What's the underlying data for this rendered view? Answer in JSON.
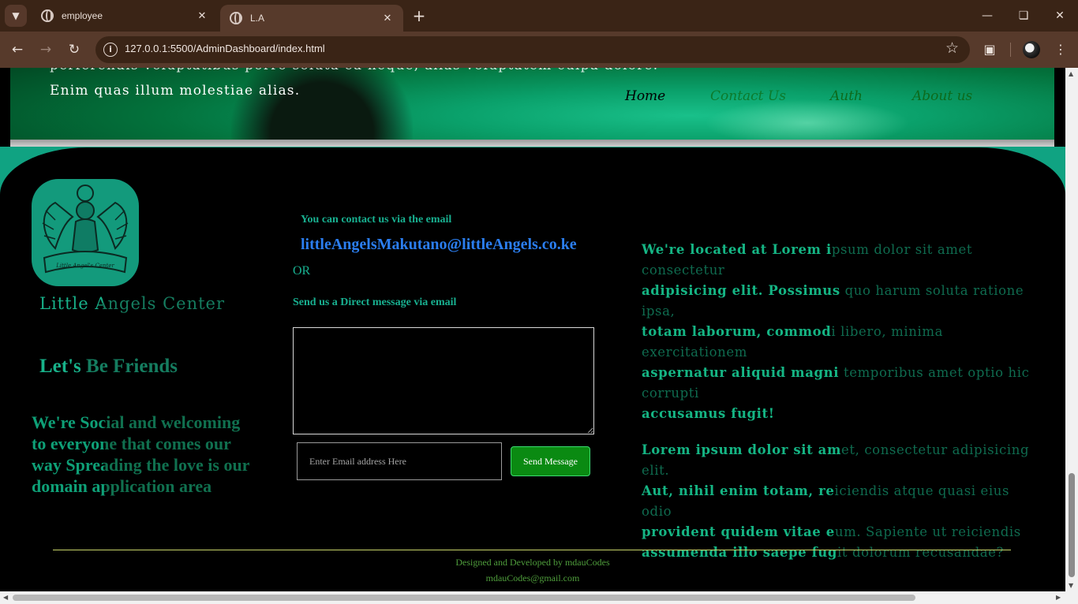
{
  "browser": {
    "tabs": [
      {
        "title": "employee",
        "active": false
      },
      {
        "title": "L.A",
        "active": true
      }
    ],
    "url": "127.0.0.1:5500/AdminDashboard/index.html",
    "icons": {
      "tab_menu": "chevron-down-icon",
      "new_tab": "plus-icon",
      "back": "back-arrow-icon",
      "forward": "forward-arrow-icon",
      "reload": "reload-icon",
      "site_info": "info-icon",
      "bookmark": "star-icon",
      "extensions": "puzzle-icon",
      "profile": "avatar-icon",
      "menu": "kebab-menu-icon"
    },
    "colors": {
      "tabbar": "#3a2416",
      "toolbar": "#573a2b"
    }
  },
  "hero": {
    "partial_line": "perferendis voluptatibus porro soluta ea neque, alias voluptatem culpa dolore.",
    "line": "Enim quas illum molestiae alias.",
    "nav": [
      {
        "label": "Home",
        "color": "#000000"
      },
      {
        "label": "Contact Us",
        "color": "#0c7a2c"
      },
      {
        "label": "Auth",
        "color": "#0d6a1c"
      },
      {
        "label": "About us",
        "color": "#0d6a1c"
      }
    ]
  },
  "footer": {
    "brand": "Little Angels Center",
    "friends_heading": "Let's Be Friends",
    "social_text": "We're Social and welcoming to everyone that comes our way Spreading the love is our domain application area",
    "contact_lead": "You can contact us via the email",
    "contact_email": "littleAngelsMakutano@littleAngels.co.ke",
    "or_text": "OR",
    "direct_label": "Send us a Direct message via email",
    "message_value": "",
    "email_placeholder": "Enter Email address Here",
    "send_label": "Send Message",
    "location_bright_1": "We're located at Lorem i",
    "location_dim_1": "psum dolor sit amet consectetur",
    "location_bright_2": "adipisicing elit. Possimus",
    "location_dim_2": " quo harum soluta ratione ipsa,",
    "location_bright_3": "totam laborum, commod",
    "location_dim_3": "i libero, minima exercitationem",
    "location_bright_4": "aspernatur aliquid magni",
    "location_dim_4": " temporibus amet optio hic corrupti",
    "location_bright_5": "accusamus fugit!",
    "lorem_bright_1": "Lorem ipsum dolor sit am",
    "lorem_dim_1": "et, consectetur adipisicing elit.",
    "lorem_bright_2": "Aut, nihil enim totam, re",
    "lorem_dim_2": "iciendis atque quasi eius odio",
    "lorem_bright_3": "provident quidem vitae e",
    "lorem_dim_3": "um. Sapiente ut reiciendis",
    "lorem_bright_4": "assumenda illo saepe fug",
    "lorem_dim_4": "it dolorum recusandae?",
    "credit_line": "Designed and Developed by mdauCodes",
    "credit_email": "mdauCodes@gmail.com",
    "colors": {
      "accent_green": "#18b090",
      "link_blue": "#2b7ef0",
      "send_button": "#0a8a12",
      "rule": "#c7d468"
    }
  }
}
